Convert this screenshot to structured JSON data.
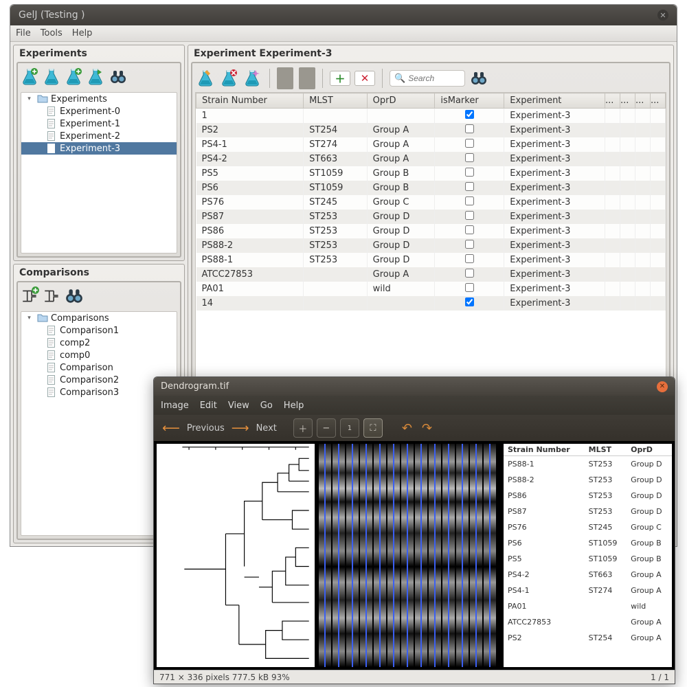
{
  "app": {
    "title": "GelJ (Testing )"
  },
  "menubar": [
    "File",
    "Tools",
    "Help"
  ],
  "experimentsPanel": {
    "title": "Experiments",
    "rootLabel": "Experiments",
    "rootOpen": true,
    "items": [
      {
        "label": "Experiment-0",
        "selected": false
      },
      {
        "label": "Experiment-1",
        "selected": false
      },
      {
        "label": "Experiment-2",
        "selected": false
      },
      {
        "label": "Experiment-3",
        "selected": true
      }
    ]
  },
  "comparisonsPanel": {
    "title": "Comparisons",
    "rootLabel": "Comparisons",
    "rootOpen": true,
    "items": [
      {
        "label": "Comparison1"
      },
      {
        "label": "comp2"
      },
      {
        "label": "comp0"
      },
      {
        "label": "Comparison"
      },
      {
        "label": "Comparison2"
      },
      {
        "label": "Comparison3"
      }
    ]
  },
  "mainPanel": {
    "title": "Experiment Experiment-3",
    "searchPlaceholder": "Search",
    "table": {
      "columns": [
        "Strain Number",
        "MLST",
        "OprD",
        "isMarker",
        "Experiment"
      ],
      "rows": [
        {
          "strain": "1",
          "mlst": "",
          "oprd": "",
          "marker": true,
          "exp": "Experiment-3"
        },
        {
          "strain": "PS2",
          "mlst": "ST254",
          "oprd": "Group A",
          "marker": false,
          "exp": "Experiment-3"
        },
        {
          "strain": "PS4-1",
          "mlst": "ST274",
          "oprd": "Group A",
          "marker": false,
          "exp": "Experiment-3"
        },
        {
          "strain": "PS4-2",
          "mlst": "ST663",
          "oprd": "Group A",
          "marker": false,
          "exp": "Experiment-3"
        },
        {
          "strain": "PS5",
          "mlst": "ST1059",
          "oprd": "Group B",
          "marker": false,
          "exp": "Experiment-3"
        },
        {
          "strain": "PS6",
          "mlst": "ST1059",
          "oprd": "Group B",
          "marker": false,
          "exp": "Experiment-3"
        },
        {
          "strain": "PS76",
          "mlst": "ST245",
          "oprd": "Group C",
          "marker": false,
          "exp": "Experiment-3"
        },
        {
          "strain": "PS87",
          "mlst": "ST253",
          "oprd": "Group D",
          "marker": false,
          "exp": "Experiment-3"
        },
        {
          "strain": "PS86",
          "mlst": "ST253",
          "oprd": "Group D",
          "marker": false,
          "exp": "Experiment-3"
        },
        {
          "strain": "PS88-2",
          "mlst": "ST253",
          "oprd": "Group D",
          "marker": false,
          "exp": "Experiment-3"
        },
        {
          "strain": "PS88-1",
          "mlst": "ST253",
          "oprd": "Group D",
          "marker": false,
          "exp": "Experiment-3"
        },
        {
          "strain": "ATCC27853",
          "mlst": "",
          "oprd": "Group A",
          "marker": false,
          "exp": "Experiment-3"
        },
        {
          "strain": "PA01",
          "mlst": "",
          "oprd": "wild",
          "marker": false,
          "exp": "Experiment-3"
        },
        {
          "strain": "14",
          "mlst": "",
          "oprd": "",
          "marker": true,
          "exp": "Experiment-3"
        }
      ]
    }
  },
  "viewer": {
    "title": "Dendrogram.tif",
    "menubar": [
      "Image",
      "Edit",
      "View",
      "Go",
      "Help"
    ],
    "nav": {
      "prev": "Previous",
      "next": "Next"
    },
    "status": {
      "left": "771 × 336 pixels   777.5 kB   93%",
      "right": "1 / 1"
    },
    "table": {
      "columns": [
        "Strain Number",
        "MLST",
        "OprD"
      ],
      "rows": [
        {
          "strain": "PS88-1",
          "mlst": "ST253",
          "oprd": "Group D"
        },
        {
          "strain": "PS88-2",
          "mlst": "ST253",
          "oprd": "Group D"
        },
        {
          "strain": "PS86",
          "mlst": "ST253",
          "oprd": "Group D"
        },
        {
          "strain": "PS87",
          "mlst": "ST253",
          "oprd": "Group D"
        },
        {
          "strain": "PS76",
          "mlst": "ST245",
          "oprd": "Group C"
        },
        {
          "strain": "PS6",
          "mlst": "ST1059",
          "oprd": "Group B"
        },
        {
          "strain": "PS5",
          "mlst": "ST1059",
          "oprd": "Group B"
        },
        {
          "strain": "PS4-2",
          "mlst": "ST663",
          "oprd": "Group A"
        },
        {
          "strain": "PS4-1",
          "mlst": "ST274",
          "oprd": "Group A"
        },
        {
          "strain": "PA01",
          "mlst": "",
          "oprd": "wild"
        },
        {
          "strain": "ATCC27853",
          "mlst": "",
          "oprd": "Group A"
        },
        {
          "strain": "PS2",
          "mlst": "ST254",
          "oprd": "Group A"
        }
      ]
    }
  },
  "icons": {
    "flask_add": "flask-add-icon",
    "flask": "flask-icon",
    "flask_edit": "flask-edit-icon",
    "flask_export": "flask-export-icon",
    "binoculars": "binoculars-icon",
    "tree_add": "dendrogram-add-icon",
    "tree": "dendrogram-icon",
    "flask_pencil": "flask-pencil-icon",
    "flask_delete": "flask-delete-icon",
    "flask_new": "flask-new-icon",
    "slide_add": "slide-add-icon",
    "slide_delete": "slide-delete-icon",
    "zoom_in": "zoom-in-icon",
    "zoom_out": "zoom-out-icon",
    "gray1": "gray-tool-1",
    "gray2": "gray-tool-2"
  }
}
